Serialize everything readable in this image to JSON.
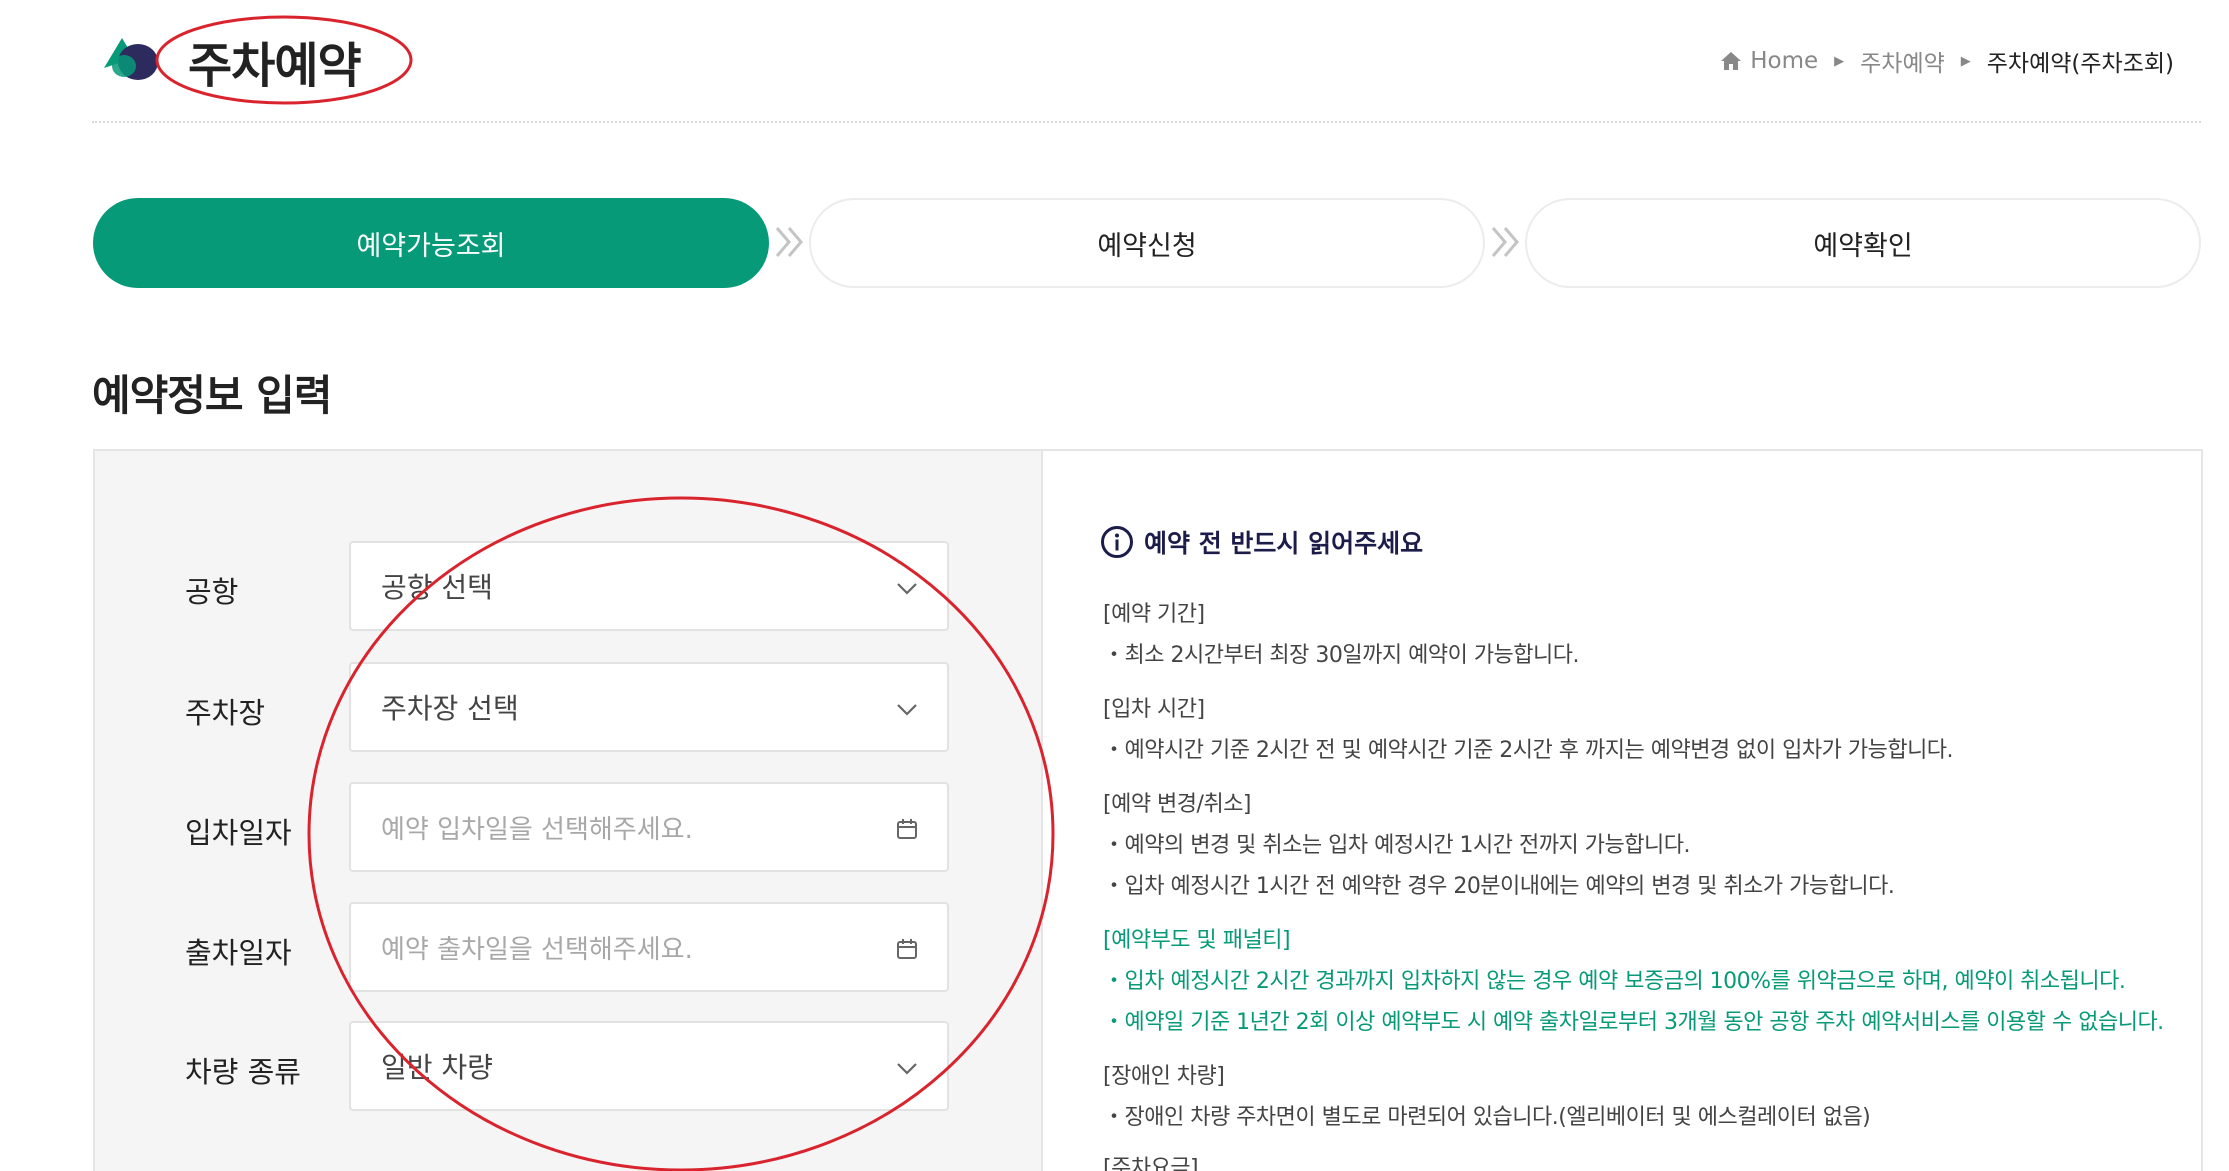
{
  "header": {
    "title": "주차예약",
    "breadcrumb": {
      "home": "Home",
      "level1": "주차예약",
      "current": "주차예약(주차조회)"
    }
  },
  "steps": [
    {
      "label": "예약가능조회",
      "active": true
    },
    {
      "label": "예약신청",
      "active": false
    },
    {
      "label": "예약확인",
      "active": false
    }
  ],
  "section_title": "예약정보 입력",
  "form": {
    "airport": {
      "label": "공항",
      "value": "공항 선택"
    },
    "parking": {
      "label": "주차장",
      "value": "주차장 선택"
    },
    "entry_date": {
      "label": "입차일자",
      "placeholder": "예약 입차일을 선택해주세요."
    },
    "exit_date": {
      "label": "출차일자",
      "placeholder": "예약 출차일을 선택해주세요."
    },
    "vehicle_type": {
      "label": "차량 종류",
      "value": "일반 차량"
    }
  },
  "notice": {
    "title": "예약 전 반드시 읽어주세요",
    "lines": [
      "[예약 기간]",
      "・최소 2시간부터 최장 30일까지 예약이 가능합니다.",
      "[입차 시간]",
      "・예약시간 기준 2시간 전 및 예약시간 기준 2시간 후 까지는 예약변경 없이 입차가 가능합니다.",
      "[예약 변경/취소]",
      "・예약의 변경 및 취소는 입차 예정시간 1시간 전까지 가능합니다.",
      "・입차 예정시간 1시간 전 예약한 경우 20분이내에는 예약의 변경 및 취소가 가능합니다.",
      "[예약부도 및 패널티]",
      "・입차 예정시간 2시간 경과까지 입차하지 않는 경우 예약 보증금의 100%를 위약금으로 하며, 예약이 취소됩니다.",
      "・예약일 기준 1년간 2회 이상 예약부도 시 예약 출차일로부터 3개월 동안 공항 주차 예약서비스를 이용할 수 없습니다.",
      "[장애인 차량]",
      "・장애인 차량 주차면이 별도로 마련되어 있습니다.(엘리베이터 및 에스컬레이터 없음)",
      "[주차요금]"
    ]
  },
  "colors": {
    "accent": "#079a78",
    "annotation": "#d9232d",
    "notice_title": "#1c1c4a"
  },
  "icons": [
    "logo-icon",
    "home-icon",
    "chevron-down-icon",
    "calendar-icon",
    "info-icon",
    "double-chevron-icon"
  ]
}
